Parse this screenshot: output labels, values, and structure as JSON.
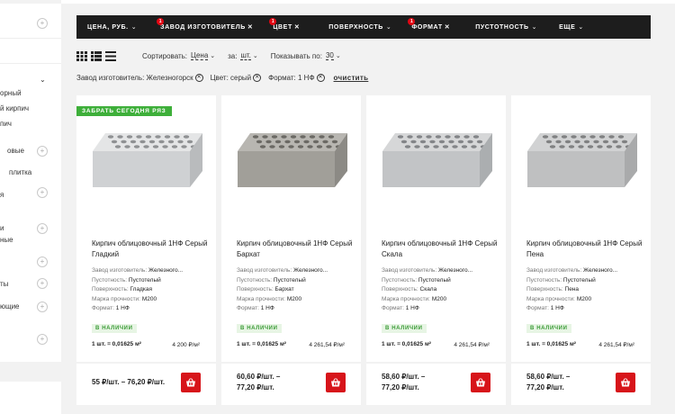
{
  "sidebar": {
    "items": [
      {
        "label": "орный"
      },
      {
        "label": "й кирпич"
      },
      {
        "label": "пич"
      },
      {
        "label": "овые"
      },
      {
        "label": "плитка"
      },
      {
        "label": "я"
      },
      {
        "label": "и"
      },
      {
        "label": "ные"
      },
      {
        "label": "ты"
      },
      {
        "label": "ющие"
      }
    ]
  },
  "filters": [
    {
      "label": "Цена, руб.",
      "kind": "chevron"
    },
    {
      "label": "Завод изготовитель",
      "kind": "active",
      "count": "1"
    },
    {
      "label": "Цвет",
      "kind": "active",
      "count": "1"
    },
    {
      "label": "Поверхность",
      "kind": "chevron"
    },
    {
      "label": "Формат",
      "kind": "active",
      "count": "1"
    },
    {
      "label": "Пустотность",
      "kind": "chevron"
    },
    {
      "label": "Еще",
      "kind": "chevron"
    }
  ],
  "toolbar": {
    "sort_label": "Сортировать:",
    "sort_value": "Цена",
    "per_label": "за:",
    "per_value": "шт.",
    "show_label": "Показывать по:",
    "show_value": "30"
  },
  "active_filters": {
    "chips": [
      "Завод изготовитель: Железногорск",
      "Цвет: серый",
      "Формат: 1 НФ"
    ],
    "clear_label": "очистить"
  },
  "labels": {
    "factory": "Завод изготовитель:",
    "voidness": "Пустотность:",
    "surface": "Поверхность:",
    "strength": "Марка прочности:",
    "format": "Формат:"
  },
  "products": [
    {
      "badge": "Забрать сегодня ряз",
      "title": "Кирпич облицовочный 1НФ Серый Гладкий",
      "factory": "Железного...",
      "voidness": "Пустотелый",
      "surface": "Гладкая",
      "strength": "М200",
      "format": "1 НФ",
      "stock": "в наличии",
      "unit": "1 шт. = 0,01625 м²",
      "price_m2": "4 200 ₽/м²",
      "price_line1": "55 ₽/шт. – 76,20 ₽/шт.",
      "price_line2": "",
      "texture": "smooth"
    },
    {
      "badge": "",
      "title": "Кирпич облицовочный 1НФ Серый Бархат",
      "factory": "Железного...",
      "voidness": "Пустотелый",
      "surface": "Бархат",
      "strength": "М200",
      "format": "1 НФ",
      "stock": "в наличии",
      "unit": "1 шт. = 0,01625 м²",
      "price_m2": "4 261,54 ₽/м²",
      "price_line1": "60,60 ₽/шт. –",
      "price_line2": "77,20 ₽/шт.",
      "texture": "velvet"
    },
    {
      "badge": "",
      "title": "Кирпич облицовочный 1НФ Серый Скала",
      "factory": "Железного...",
      "voidness": "Пустотелый",
      "surface": "Скала",
      "strength": "М200",
      "format": "1 НФ",
      "stock": "в наличии",
      "unit": "1 шт. = 0,01625 м²",
      "price_m2": "4 261,54 ₽/м²",
      "price_line1": "58,60 ₽/шт. –",
      "price_line2": "77,20 ₽/шт.",
      "texture": "rock"
    },
    {
      "badge": "",
      "title": "Кирпич облицовочный 1НФ Серый Пена",
      "factory": "Железного...",
      "voidness": "Пустотелый",
      "surface": "Пена",
      "strength": "М200",
      "format": "1 НФ",
      "stock": "в наличии",
      "unit": "1 шт. = 0,01625 м²",
      "price_m2": "4 261,54 ₽/м²",
      "price_line1": "58,60 ₽/шт. –",
      "price_line2": "77,20 ₽/шт.",
      "texture": "foam"
    }
  ],
  "colors": {
    "filterbar": "#1d1d1d",
    "accent_red": "#d7141a",
    "badge_green": "#3eaf3a",
    "stock_green": "#3a9a36"
  }
}
